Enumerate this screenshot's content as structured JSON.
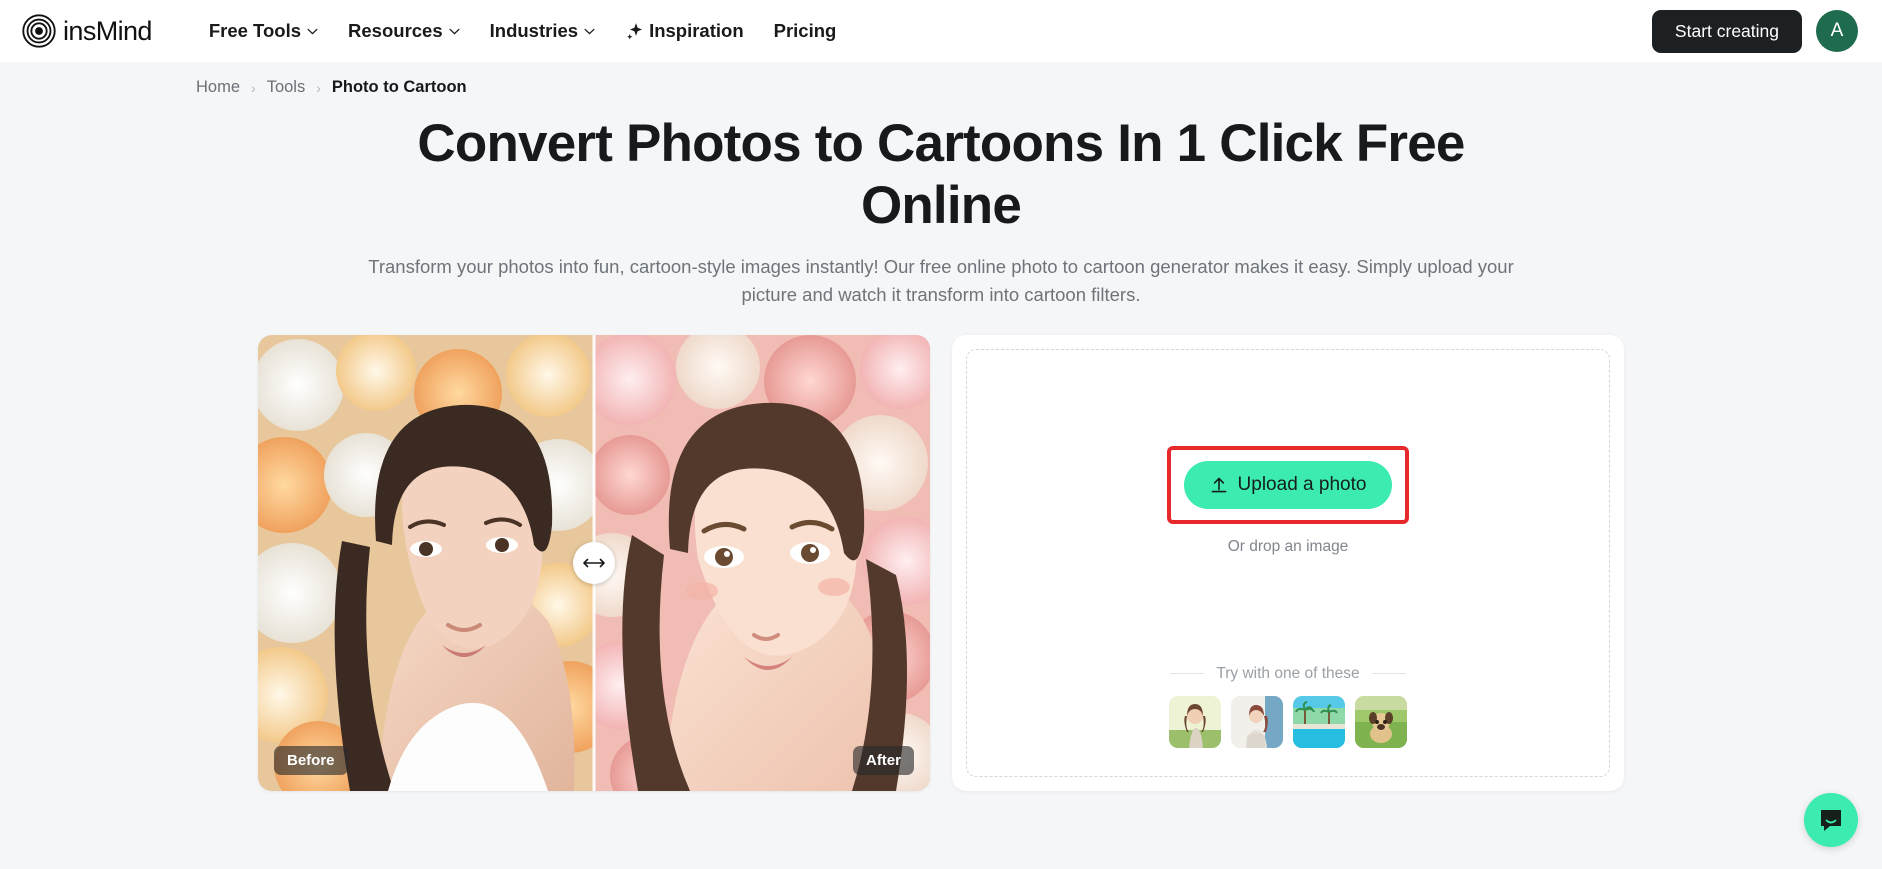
{
  "brand": {
    "name": "insMind",
    "logo_icon": "concentric-rings-logo"
  },
  "nav": {
    "items": [
      {
        "label": "Free Tools",
        "has_dropdown": true
      },
      {
        "label": "Resources",
        "has_dropdown": true
      },
      {
        "label": "Industries",
        "has_dropdown": true
      },
      {
        "label": "Inspiration",
        "has_dropdown": false,
        "icon": "sparkle-icon"
      },
      {
        "label": "Pricing",
        "has_dropdown": false
      }
    ],
    "start_button": "Start creating",
    "avatar_initial": "A"
  },
  "breadcrumb": {
    "home": "Home",
    "tools": "Tools",
    "current": "Photo to Cartoon",
    "separator": "›"
  },
  "hero": {
    "title": "Convert Photos to Cartoons In 1 Click Free Online",
    "subtitle": "Transform your photos into fun, cartoon-style images instantly! Our free online photo to cartoon generator makes it easy. Simply upload your picture and watch it transform into cartoon filters."
  },
  "comparison": {
    "before_label": "Before",
    "after_label": "After",
    "handle_icon": "horizontal-resize-arrows-icon",
    "divider_position_percent": 50
  },
  "upload": {
    "button_label": "Upload a photo",
    "button_icon": "upload-arrow-icon",
    "drop_hint": "Or drop an image",
    "highlight_color": "#e8292b",
    "button_color": "#3cebb0",
    "samples_label": "Try with one of these",
    "samples": [
      {
        "name": "woman-in-field"
      },
      {
        "name": "woman-by-wall"
      },
      {
        "name": "pool-with-palms"
      },
      {
        "name": "pug-on-grass"
      }
    ]
  },
  "chat": {
    "icon": "chat-bubble-icon",
    "color": "#3cebb0"
  }
}
